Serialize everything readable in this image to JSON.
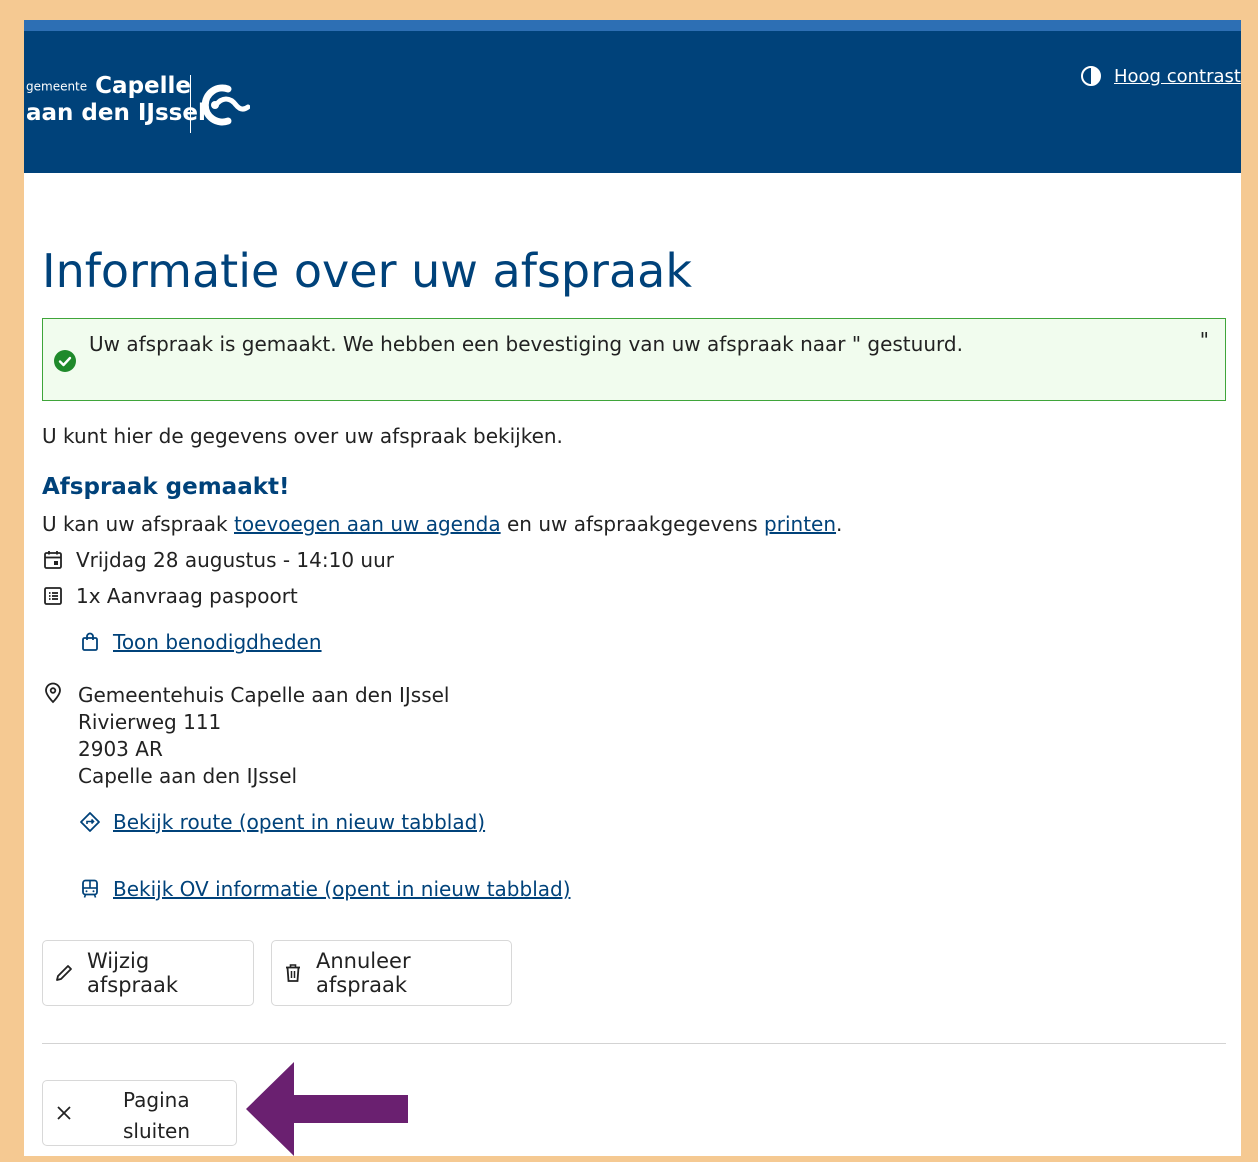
{
  "header": {
    "logo_small": "gemeente",
    "logo_line1": "Capelle",
    "logo_line2": "aan den IJssel",
    "contrast_label": "Hoog contrast"
  },
  "main": {
    "title": "Informatie over uw afspraak",
    "alert_text": "Uw afspraak is gemaakt. We hebben een bevestiging van uw afspraak naar \" gestuurd.",
    "alert_quote": "\"",
    "intro": "U kunt hier de gegevens over uw afspraak bekijken.",
    "subheading": "Afspraak gemaakt!",
    "line_prefix": "U kan uw afspraak ",
    "agenda_link": "toevoegen aan uw agenda",
    "line_middle": " en uw afspraakgegevens ",
    "print_link": "printen",
    "line_suffix": ".",
    "date": "Vrijdag 28 augustus - 14:10 uur",
    "product": "1x Aanvraag paspoort",
    "requirements_link": "Toon benodigdheden",
    "location": {
      "name": "Gemeentehuis Capelle aan den IJssel",
      "street": "Rivierweg 111",
      "postcode": "2903 AR",
      "city": "Capelle aan den IJssel"
    },
    "route_link": "Bekijk route (opent in nieuw tabblad)",
    "ov_link": "Bekijk OV informatie (opent in nieuw tabblad)",
    "edit_button": "Wijzig afspraak",
    "cancel_button": "Annuleer afspraak",
    "close_line1": "Pagina",
    "close_line2": "sluiten"
  },
  "colors": {
    "brand": "#00427a",
    "success": "#3fa53a",
    "annotation_arrow": "#6a2070",
    "border_frame": "#f5c992"
  }
}
